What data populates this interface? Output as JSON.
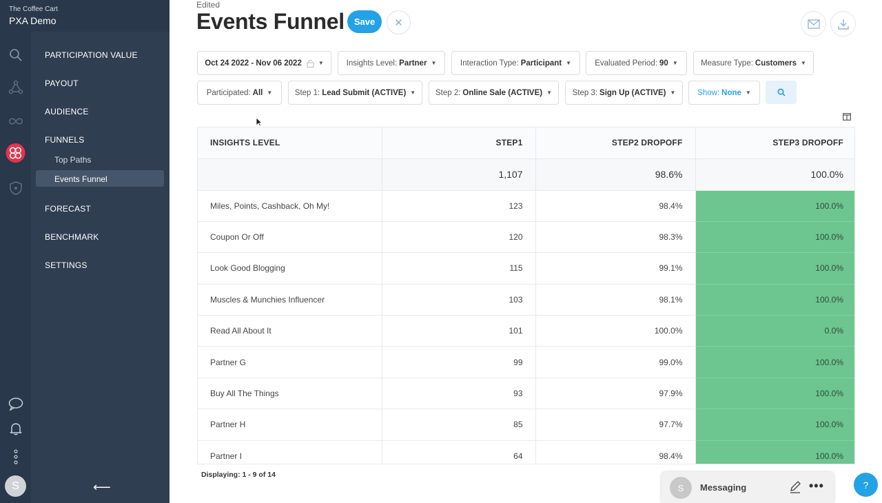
{
  "brand": {
    "org": "The Coffee Cart",
    "app": "PXA Demo"
  },
  "nav": {
    "items": [
      {
        "label": "PARTICIPATION VALUE"
      },
      {
        "label": "PAYOUT"
      },
      {
        "label": "AUDIENCE"
      },
      {
        "label": "FUNNELS"
      },
      {
        "label": "FORECAST"
      },
      {
        "label": "BENCHMARK"
      },
      {
        "label": "SETTINGS"
      }
    ],
    "subitems": [
      {
        "label": "Top Paths"
      },
      {
        "label": "Events Funnel"
      }
    ],
    "collapse": "⟵"
  },
  "user": {
    "initial": "S"
  },
  "header": {
    "edited": "Edited",
    "title": "Events Funnel",
    "save_label": "Save",
    "close_glyph": "✕"
  },
  "filters": {
    "date": "Oct 24 2022 - Nov 06 2022",
    "insights": {
      "label": "Insights Level:",
      "value": "Partner"
    },
    "interaction": {
      "label": "Interaction Type:",
      "value": "Participant"
    },
    "evaluated": {
      "label": "Evaluated Period:",
      "value": "90"
    },
    "measure": {
      "label": "Measure Type:",
      "value": "Customers"
    },
    "participated": {
      "label": "Participated:",
      "value": "All"
    },
    "step1": {
      "label": "Step 1:",
      "value": "Lead Submit (ACTIVE)"
    },
    "step2": {
      "label": "Step 2:",
      "value": "Online Sale (ACTIVE)"
    },
    "step3": {
      "label": "Step 3:",
      "value": "Sign Up (ACTIVE)"
    },
    "show": {
      "label": "Show:",
      "value": "None"
    },
    "caret": "▼"
  },
  "table": {
    "headers": [
      "INSIGHTS LEVEL",
      "STEP1",
      "STEP2 DROPOFF",
      "STEP3 DROPOFF"
    ],
    "total": [
      "",
      "1,107",
      "98.6%",
      "100.0%"
    ],
    "rows": [
      [
        "Miles, Points, Cashback, Oh My!",
        "123",
        "98.4%",
        "100.0%"
      ],
      [
        "Coupon Or Off",
        "120",
        "98.3%",
        "100.0%"
      ],
      [
        "Look Good Blogging",
        "115",
        "99.1%",
        "100.0%"
      ],
      [
        "Muscles & Munchies Influencer",
        "103",
        "98.1%",
        "100.0%"
      ],
      [
        "Read All About It",
        "101",
        "100.0%",
        "0.0%"
      ],
      [
        "Partner G",
        "99",
        "99.0%",
        "100.0%"
      ],
      [
        "Buy All The Things",
        "93",
        "97.9%",
        "100.0%"
      ],
      [
        "Partner H",
        "85",
        "97.7%",
        "100.0%"
      ],
      [
        "Partner I",
        "64",
        "98.4%",
        "100.0%"
      ]
    ],
    "highlight_color": "#6dc58f"
  },
  "footer": {
    "displaying": "Displaying: 1 - 9 of 14"
  },
  "messaging": {
    "initial": "S",
    "label": "Messaging",
    "more": "•••"
  },
  "help": {
    "glyph": "?"
  },
  "colors": {
    "accent": "#23a2e6",
    "sidebar": "#2f3e51",
    "rail": "#29384a",
    "funnels_icon": "#e2344f"
  }
}
